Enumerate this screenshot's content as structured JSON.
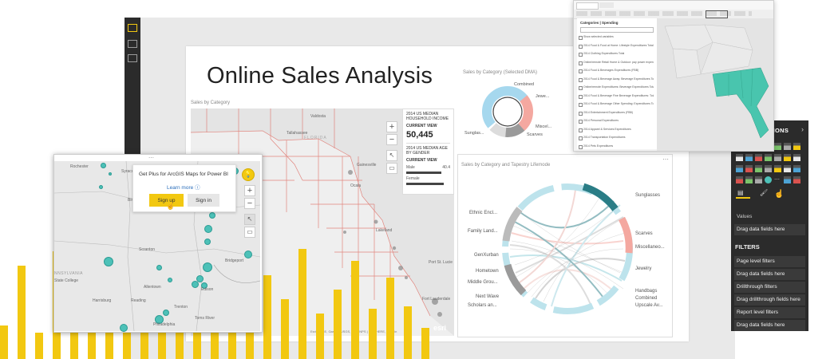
{
  "report": {
    "title": "Online Sales Analysis"
  },
  "florida_map": {
    "title": "Sales by Category",
    "places": [
      "Valdosta",
      "Tallahassee",
      "FLORIDA",
      "Gainesville",
      "Ocala",
      "Lakeland",
      "Port St. Lucie",
      "Fort Lauderdale"
    ],
    "info": {
      "household_label": "2014 US MEDIAN HOUSEHOLD INCOME",
      "current_view_label": "CURRENT VIEW",
      "household_value": "50,445",
      "age_label": "2014 US MEDIAN AGE BY GENDER",
      "current_view_label2": "CURRENT VIEW",
      "male_label": "Male",
      "male_value": "40.4",
      "female_label": "Female"
    },
    "attribution": "Esri, HERE, Garmin, USGS, EPA, NPS | Esri, HERE, Garmin",
    "esri_logo": "esri"
  },
  "donut": {
    "title": "Sales by Category (Selected DMA)",
    "labels": [
      "Combined",
      "Jewe...",
      "Miscel...",
      "Scarves",
      "Sunglas..."
    ],
    "colors": [
      "#a6d8ee",
      "#f4a8a0",
      "#9a9a9a",
      "#e8e8e8"
    ]
  },
  "chord": {
    "title": "Sales by Category and Tapestry Lifemode",
    "left_labels": [
      "Ethnic Encl...",
      "Family Land...",
      "GenXurban",
      "Hometown",
      "Middle Grou...",
      "Next Wave",
      "Scholars an..."
    ],
    "right_labels": [
      "Sunglasses",
      "Scarves",
      "Miscellaneo...",
      "Jewelry",
      "Handbags",
      "Combined",
      "Upscale Av..."
    ]
  },
  "arcgis_popup": {
    "promo_text": "Get Plus for ArcGIS Maps for Power BI",
    "learn_more": "Learn more",
    "sign_up": "Sign up",
    "sign_in": "Sign in",
    "places": [
      "Rochester",
      "Syracu...",
      "Binghamton",
      "Scranton",
      "NNSYLVANIA",
      "State College",
      "Allentown",
      "Edison",
      "Harrisburg",
      "Reading",
      "Trenton",
      "Toms River",
      "Philadelphia",
      "Bridgeport"
    ]
  },
  "visualizations_pane": {
    "title": "VISUALIZATIONS",
    "values_label": "Values",
    "drag_values": "Drag data fields here",
    "filters_title": "FILTERS",
    "page_filters": "Page level filters",
    "drag_page": "Drag data fields here",
    "drillthrough": "Drillthrough filters",
    "drag_drill": "Drag drillthrough fields here",
    "report_filters": "Report level filters",
    "drag_report": "Drag data fields here"
  },
  "top_screenshot": {
    "panel_title": "Categories | Spending",
    "rows": [
      "Show selected variables",
      "2014 Food & Food at Home: Lifestyle Expenditures Total",
      "2014 Clothing Expenditures Total",
      "Online/remote Retail Home & Outdoor: pay power expenditures",
      "2014 Food & Beverages Expenditures (FBB)",
      "2014 Food & Beverage Away: Beverage Expenditures Total",
      "Online/remote Expenditures: Beverage Expenditures Total",
      "2014 Food & Beverage Fine Beverage Expenditures: Total",
      "2014 Food & Beverage Other Spending: Expenditures Total",
      "2014 Entertainment Expenditures (FBB)",
      "2014 Personal Expenditures",
      "2014 Apparel & Services Expenditures",
      "2014 Transportation Expenditures",
      "2014 Pets Expenditures"
    ]
  },
  "colors": {
    "accent_yellow": "#f2c811",
    "teal": "#4dc1b8",
    "pane_dark": "#2b2b2b",
    "map_red": "#e07a72"
  },
  "yellow_bars": [
    0.28,
    0.78,
    0.22,
    0.9,
    0.34,
    0.55,
    0.4,
    0.62,
    0.74,
    0.3,
    0.52,
    0.24,
    0.46,
    0.6,
    0.36,
    0.7,
    0.5,
    0.92,
    0.38,
    0.58,
    0.82,
    0.42,
    0.68,
    0.44,
    0.26
  ]
}
